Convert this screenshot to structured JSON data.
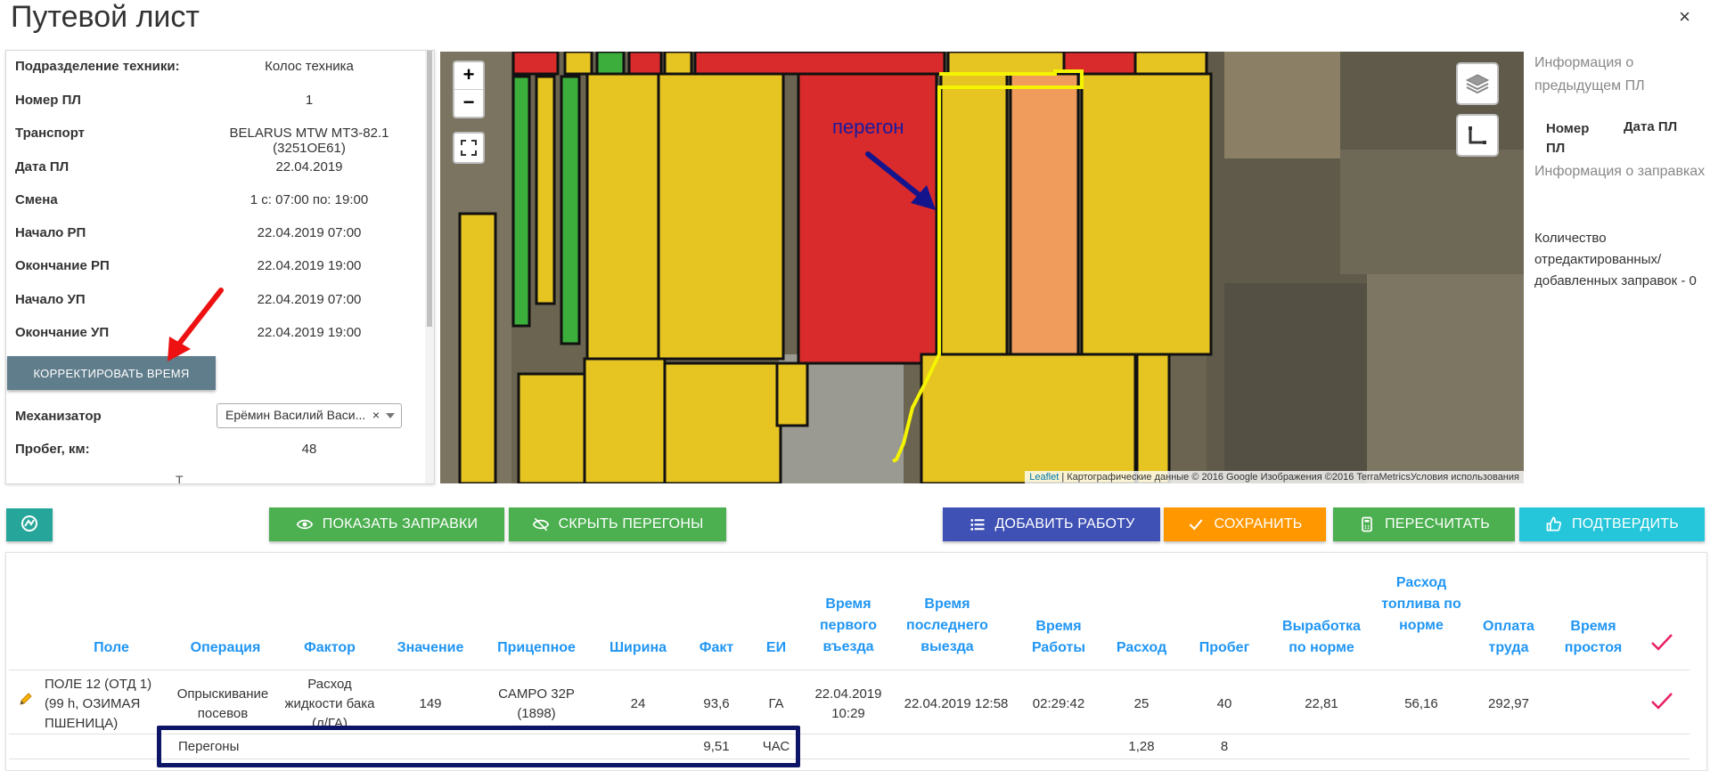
{
  "window": {
    "title": "Путевой лист",
    "close_glyph": "×"
  },
  "info": {
    "rows": [
      {
        "label": "Подразделение техники:",
        "value": "Колос техника"
      },
      {
        "label": "Номер ПЛ",
        "value": "1"
      },
      {
        "label": "Транспорт",
        "value": "BELARUS MTW МТЗ-82.1 (3251ОЕ61)"
      },
      {
        "label": "Дата ПЛ",
        "value": "22.04.2019"
      },
      {
        "label": "Смена",
        "value": "1 с: 07:00 по: 19:00"
      },
      {
        "label": "Начало РП",
        "value": "22.04.2019 07:00"
      },
      {
        "label": "Окончание РП",
        "value": "22.04.2019 19:00"
      },
      {
        "label": "Начало УП",
        "value": "22.04.2019 07:00"
      },
      {
        "label": "Окончание УП",
        "value": "22.04.2019 19:00"
      }
    ],
    "correct_button": "КОРРЕКТИРОВАТЬ ВРЕМЯ",
    "mechanic_label": "Механизатор",
    "mechanic_value": "Ерёмин Василий Васи...",
    "mechanic_clear": "×",
    "mileage_label": "Пробег, км:",
    "mileage_value": "48",
    "cut_glyph": "Т"
  },
  "map": {
    "zoom_in": "+",
    "zoom_out": "−",
    "annotation": "перегон",
    "attribution_link": "Leaflet",
    "attribution_text": " | Картографические данные © 2016 Google Изображения ©2016 TerraMetricsУсловия использования",
    "colors": {
      "yellow": "#e6c421",
      "red": "#d92b2b",
      "orange": "#ef9c5c",
      "green": "#3cae3c",
      "route": "#f4f400"
    }
  },
  "right": {
    "prev_info": "Информация о предыдущем ПЛ",
    "col_number": "Номер ПЛ",
    "col_date": "Дата ПЛ",
    "refuel_info": "Информация о заправках",
    "edited_count": "Количество отредактированных/ добавленных заправок - 0"
  },
  "toolbar": {
    "show_refuels": "ПОКАЗАТЬ ЗАПРАВКИ",
    "hide_transfers": "СКРЫТЬ ПЕРЕГОНЫ",
    "add_work": "ДОБАВИТЬ РАБОТУ",
    "save": "СОХРАНИТЬ",
    "recalc": "ПЕРЕСЧИТАТЬ",
    "confirm": "ПОДТВЕРДИТЬ"
  },
  "table": {
    "headers": {
      "field": "Поле",
      "operation": "Операция",
      "factor": "Фактор",
      "value": "Значение",
      "trailer": "Прицепное",
      "width": "Ширина",
      "fact": "Факт",
      "unit": "ЕИ",
      "first_entry": "Время первого въезда",
      "last_exit": "Время последнего выезда",
      "work_time": "Время Работы",
      "consumption": "Расход",
      "mileage": "Пробег",
      "norm_output": "Выработка по норме",
      "norm_fuel": "Расход топлива по норме",
      "payment": "Оплата труда",
      "idle": "Время простоя"
    },
    "row1": {
      "field": "ПОЛЕ 12 (ОТД 1) (99 h, ОЗИМАЯ ПШЕНИЦА)",
      "operation": "Опрыскивание посевов",
      "factor": "Расход жидкости бака (л/ГА)",
      "value": "149",
      "trailer": "CAMPO 32P (1898)",
      "width": "24",
      "fact": "93,6",
      "unit": "ГА",
      "first_entry": "22.04.2019 10:29",
      "last_exit": "22.04.2019 12:58",
      "work_time": "02:29:42",
      "consumption": "25",
      "mileage": "40",
      "norm_output": "22,81",
      "norm_fuel": "56,16",
      "payment": "292,97"
    },
    "row2": {
      "operation": "Перегоны",
      "fact": "9,51",
      "unit": "ЧАС",
      "consumption": "1,28",
      "mileage": "8"
    }
  }
}
